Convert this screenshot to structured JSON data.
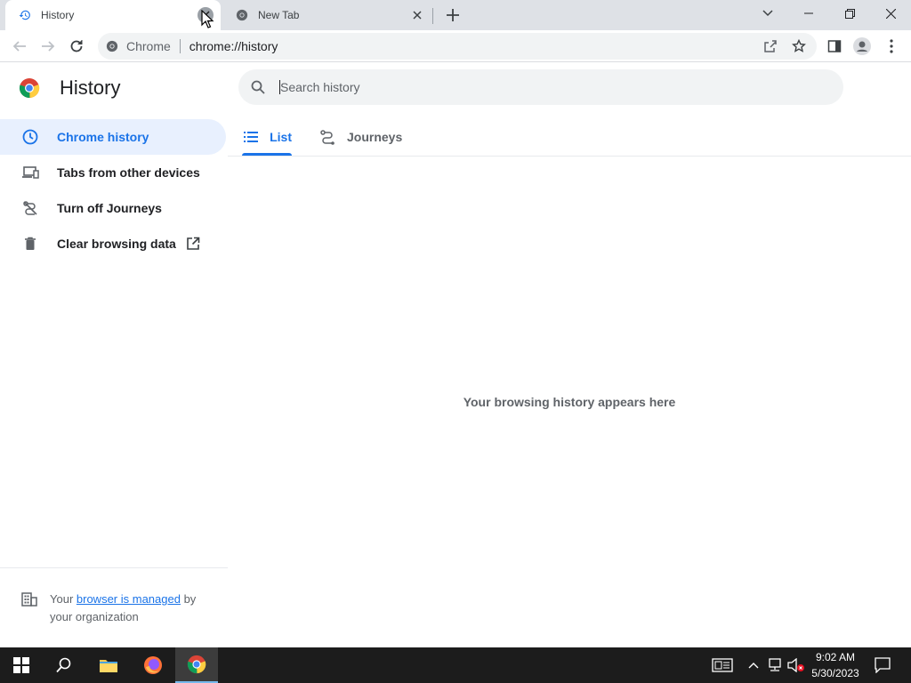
{
  "browser": {
    "tabs": [
      {
        "title": "History",
        "active": true
      },
      {
        "title": "New Tab",
        "active": false
      }
    ],
    "omnibox": {
      "chip": "Chrome",
      "url": "chrome://history"
    }
  },
  "sidebar": {
    "title": "History",
    "items": [
      {
        "label": "Chrome history",
        "icon": "clock-icon",
        "selected": true
      },
      {
        "label": "Tabs from other devices",
        "icon": "devices-icon",
        "selected": false
      },
      {
        "label": "Turn off Journeys",
        "icon": "journeys-off-icon",
        "selected": false
      },
      {
        "label": "Clear browsing data",
        "icon": "trash-icon",
        "selected": false
      }
    ],
    "managed": {
      "prefix": "Your ",
      "link": "browser is managed",
      "suffix": " by your organization"
    }
  },
  "main": {
    "search": {
      "placeholder": "Search history",
      "value": ""
    },
    "tabs": [
      {
        "label": "List",
        "selected": true
      },
      {
        "label": "Journeys",
        "selected": false
      }
    ],
    "empty_message": "Your browsing history appears here"
  },
  "taskbar": {
    "time": "9:02 AM",
    "date": "5/30/2023"
  },
  "colors": {
    "accent": "#1a73e8",
    "selected_bg": "#e8f0fe",
    "tabstrip_bg": "#dee1e6",
    "taskbar_bg": "#1c1c1c"
  }
}
